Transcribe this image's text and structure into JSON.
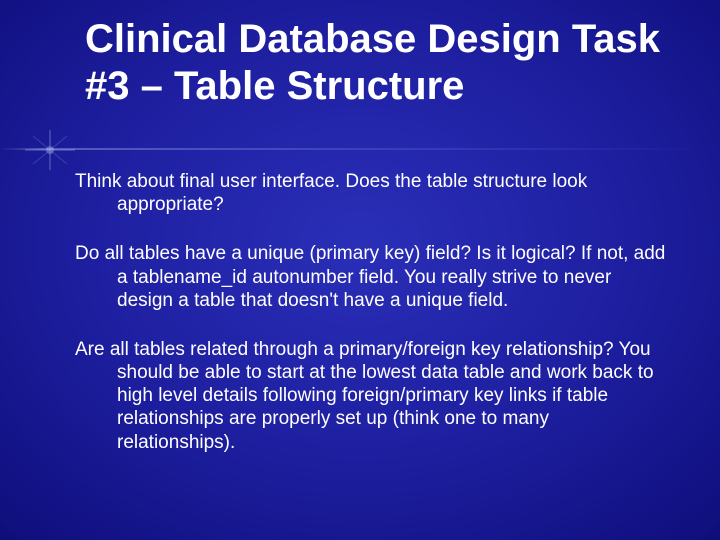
{
  "slide": {
    "title": "Clinical Database Design Task #3 – Table Structure",
    "paragraphs": [
      "Think about final user interface.  Does the table structure look appropriate?",
      "Do all tables have a unique (primary key) field?  Is it logical?  If not, add a tablename_id autonumber field.  You really strive to never design a table that doesn't have a unique field.",
      "Are all tables related through a primary/foreign key relationship?  You should be able to start at the lowest data table and work back to high level details following foreign/primary key links if table relationships are properly set up (think one to many relationships)."
    ]
  }
}
